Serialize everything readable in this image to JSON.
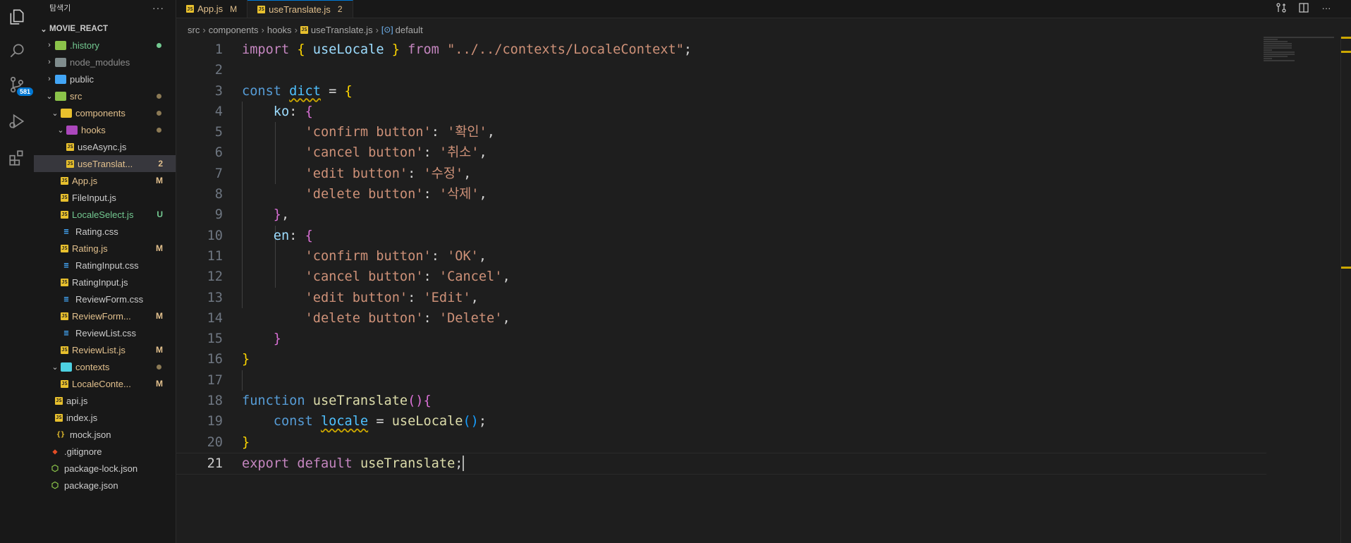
{
  "colors": {
    "accent": "#0078d4",
    "modified": "#e2c08d",
    "untracked": "#73c991",
    "error": "#f48771"
  },
  "activity_bar": {
    "items": [
      "explorer-icon",
      "search-icon",
      "source-control-icon",
      "run-debug-icon",
      "extensions-icon"
    ],
    "source_control_badge": "581"
  },
  "sidebar": {
    "title": "탐색기",
    "more": "···",
    "project": "MOVIE_REACT",
    "tree": [
      {
        "name": ".history",
        "type": "folder",
        "depth": 1,
        "expanded": false,
        "status": "untracked-dot",
        "color": "untracked"
      },
      {
        "name": "node_modules",
        "type": "folder",
        "depth": 1,
        "expanded": false,
        "color": "ignored"
      },
      {
        "name": "public",
        "type": "folder",
        "depth": 1,
        "expanded": false
      },
      {
        "name": "src",
        "type": "folder",
        "depth": 1,
        "expanded": true,
        "status": "dot",
        "color": "modified"
      },
      {
        "name": "components",
        "type": "folder",
        "depth": 2,
        "expanded": true,
        "status": "dot",
        "color": "modified"
      },
      {
        "name": "hooks",
        "type": "folder",
        "depth": 3,
        "expanded": true,
        "status": "dot",
        "color": "modified"
      },
      {
        "name": "useAsync.js",
        "type": "js",
        "depth": 4
      },
      {
        "name": "useTranslat...",
        "type": "js",
        "depth": 4,
        "badge": "2",
        "color": "modified",
        "selected": true
      },
      {
        "name": "App.js",
        "type": "js",
        "depth": 3,
        "badge": "M",
        "color": "modified"
      },
      {
        "name": "FileInput.js",
        "type": "js",
        "depth": 3
      },
      {
        "name": "LocaleSelect.js",
        "type": "js",
        "depth": 3,
        "badge": "U",
        "color": "untracked"
      },
      {
        "name": "Rating.css",
        "type": "css",
        "depth": 3
      },
      {
        "name": "Rating.js",
        "type": "js",
        "depth": 3,
        "badge": "M",
        "color": "modified"
      },
      {
        "name": "RatingInput.css",
        "type": "css",
        "depth": 3
      },
      {
        "name": "RatingInput.js",
        "type": "js",
        "depth": 3
      },
      {
        "name": "ReviewForm.css",
        "type": "css",
        "depth": 3
      },
      {
        "name": "ReviewForm...",
        "type": "js",
        "depth": 3,
        "badge": "M",
        "color": "modified"
      },
      {
        "name": "ReviewList.css",
        "type": "css",
        "depth": 3
      },
      {
        "name": "ReviewList.js",
        "type": "js",
        "depth": 3,
        "badge": "M",
        "color": "modified"
      },
      {
        "name": "contexts",
        "type": "folder",
        "depth": 2,
        "expanded": true,
        "status": "dot",
        "color": "modified"
      },
      {
        "name": "LocaleConte...",
        "type": "js",
        "depth": 3,
        "badge": "M",
        "color": "modified"
      },
      {
        "name": "api.js",
        "type": "js",
        "depth": 2
      },
      {
        "name": "index.js",
        "type": "js",
        "depth": 2
      },
      {
        "name": "mock.json",
        "type": "json",
        "depth": 2
      },
      {
        "name": ".gitignore",
        "type": "git",
        "depth": 1
      },
      {
        "name": "package-lock.json",
        "type": "pkg",
        "depth": 1
      },
      {
        "name": "package.json",
        "type": "pkg",
        "depth": 1
      }
    ]
  },
  "tabs": [
    {
      "label": "App.js",
      "indicator": "M",
      "active": false
    },
    {
      "label": "useTranslate.js",
      "indicator": "2",
      "active": true
    }
  ],
  "breadcrumb": [
    "src",
    "components",
    "hooks",
    "useTranslate.js",
    "default"
  ],
  "editor": {
    "current_line": 21,
    "lines": [
      [
        [
          "kw",
          "import "
        ],
        [
          "b1",
          "{ "
        ],
        [
          "var",
          "useLocale"
        ],
        [
          "b1",
          " }"
        ],
        [
          "kw",
          " from "
        ],
        [
          "str",
          "\"../../contexts/LocaleContext\""
        ],
        [
          "",
          "; "
        ]
      ],
      [],
      [
        [
          "kw2",
          "const "
        ],
        [
          "var2 squiggle",
          "dict"
        ],
        [
          "",
          " = "
        ],
        [
          "b1",
          "{"
        ]
      ],
      [
        [
          "",
          "    "
        ],
        [
          "var",
          "ko"
        ],
        [
          "",
          ": "
        ],
        [
          "b2",
          "{"
        ]
      ],
      [
        [
          "",
          "        "
        ],
        [
          "str",
          "'confirm button'"
        ],
        [
          "",
          ": "
        ],
        [
          "str",
          "'확인'"
        ],
        [
          "",
          ","
        ]
      ],
      [
        [
          "",
          "        "
        ],
        [
          "str",
          "'cancel button'"
        ],
        [
          "",
          ": "
        ],
        [
          "str",
          "'취소'"
        ],
        [
          "",
          ","
        ]
      ],
      [
        [
          "",
          "        "
        ],
        [
          "str",
          "'edit button'"
        ],
        [
          "",
          ": "
        ],
        [
          "str",
          "'수정'"
        ],
        [
          "",
          ","
        ]
      ],
      [
        [
          "",
          "        "
        ],
        [
          "str",
          "'delete button'"
        ],
        [
          "",
          ": "
        ],
        [
          "str",
          "'삭제'"
        ],
        [
          "",
          ","
        ]
      ],
      [
        [
          "",
          "    "
        ],
        [
          "b2",
          "}"
        ],
        [
          "",
          ","
        ]
      ],
      [
        [
          "",
          "    "
        ],
        [
          "var",
          "en"
        ],
        [
          "",
          ": "
        ],
        [
          "b2",
          "{"
        ]
      ],
      [
        [
          "",
          "        "
        ],
        [
          "str",
          "'confirm button'"
        ],
        [
          "",
          ": "
        ],
        [
          "str",
          "'OK'"
        ],
        [
          "",
          ","
        ]
      ],
      [
        [
          "",
          "        "
        ],
        [
          "str",
          "'cancel button'"
        ],
        [
          "",
          ": "
        ],
        [
          "str",
          "'Cancel'"
        ],
        [
          "",
          ","
        ]
      ],
      [
        [
          "",
          "        "
        ],
        [
          "str",
          "'edit button'"
        ],
        [
          "",
          ": "
        ],
        [
          "str",
          "'Edit'"
        ],
        [
          "",
          ","
        ]
      ],
      [
        [
          "",
          "        "
        ],
        [
          "str",
          "'delete button'"
        ],
        [
          "",
          ": "
        ],
        [
          "str",
          "'Delete'"
        ],
        [
          "",
          ","
        ]
      ],
      [
        [
          "",
          "    "
        ],
        [
          "b2",
          "}"
        ]
      ],
      [
        [
          "b1",
          "}"
        ]
      ],
      [],
      [
        [
          "kw2",
          "function "
        ],
        [
          "fn",
          "useTranslate"
        ],
        [
          "b2",
          "()"
        ],
        [
          "b2",
          "{"
        ]
      ],
      [
        [
          "",
          "    "
        ],
        [
          "kw2",
          "const "
        ],
        [
          "var2 squiggle",
          "locale"
        ],
        [
          "",
          " = "
        ],
        [
          "fn",
          "useLocale"
        ],
        [
          "b3",
          "()"
        ],
        [
          "",
          ";"
        ]
      ],
      [
        [
          "b1",
          "}"
        ]
      ],
      [
        [
          "kw",
          "export "
        ],
        [
          "kw",
          "default "
        ],
        [
          "fn",
          "useTranslate"
        ],
        [
          "",
          ";"
        ]
      ]
    ]
  }
}
